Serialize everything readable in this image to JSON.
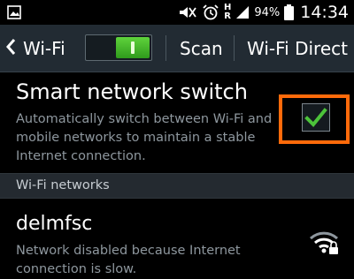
{
  "status_bar": {
    "icons": [
      "gallery-icon",
      "mute-icon",
      "alarm-icon",
      "hplus-data-icon",
      "signal-icon",
      "battery-icon"
    ],
    "network_type": "H\nR",
    "battery_percent": "94%",
    "time": "14:34"
  },
  "action_bar": {
    "title": "Wi-Fi",
    "toggle_state": "on",
    "scan_label": "Scan",
    "wifi_direct_label": "Wi-Fi Direct"
  },
  "smart_network_switch": {
    "title": "Smart network switch",
    "description": "Automatically switch between Wi-Fi and mobile networks to maintain a stable Internet connection.",
    "checked": true
  },
  "section_header": "Wi-Fi networks",
  "networks": [
    {
      "name": "delmfsc",
      "status": "Network disabled because Internet connection is slow.",
      "secured": true
    }
  ],
  "colors": {
    "highlight": "#ff6a0a",
    "check": "#4cc33a",
    "action_bar": "#222b33"
  }
}
